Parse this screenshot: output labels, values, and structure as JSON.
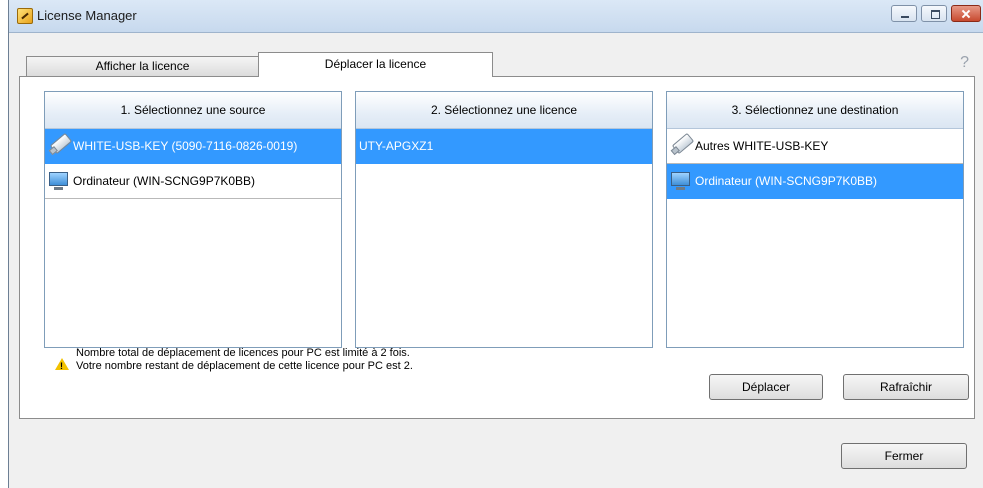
{
  "window": {
    "title": "License Manager"
  },
  "tabs": [
    {
      "label": "Afficher la licence",
      "active": false
    },
    {
      "label": "Déplacer la licence",
      "active": true
    }
  ],
  "help_label": "?",
  "panels": {
    "source": {
      "header": "1. Sélectionnez une source",
      "items": [
        {
          "label": "WHITE-USB-KEY (5090-7116-0826-0019)",
          "icon": "usb-key-icon",
          "selected": true
        },
        {
          "label": "Ordinateur (WIN-SCNG9P7K0BB)",
          "icon": "computer-icon",
          "selected": false
        }
      ]
    },
    "license": {
      "header": "2. Sélectionnez une licence",
      "items": [
        {
          "label": "UTY-APGXZ1",
          "selected": true
        }
      ]
    },
    "destination": {
      "header": "3. Sélectionnez une destination",
      "items": [
        {
          "label": "Autres WHITE-USB-KEY",
          "icon": "usb-key-icon",
          "selected": false
        },
        {
          "label": "Ordinateur (WIN-SCNG9P7K0BB)",
          "icon": "computer-icon",
          "selected": true
        }
      ]
    }
  },
  "warning": {
    "line1": "Nombre total de déplacement de licences pour PC est limité à 2 fois.",
    "line2": "Votre nombre restant de déplacement de cette licence pour PC est 2."
  },
  "buttons": {
    "move": "Déplacer",
    "refresh": "Rafraîchir",
    "close": "Fermer"
  },
  "colors": {
    "selection": "#3399ff",
    "window_chrome": "#c7d9ee",
    "close_button": "#c84a2f"
  }
}
